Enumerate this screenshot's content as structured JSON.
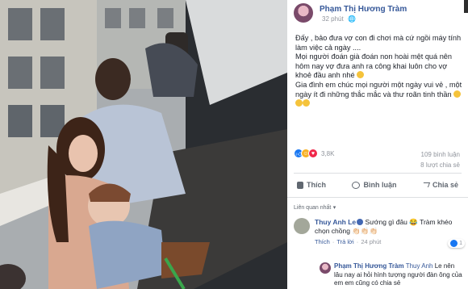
{
  "post": {
    "author": "Phạm Thị Hương Tràm",
    "time": "32 phút",
    "paragraphs": [
      "Đấy , bảo đưa vợ con đi chơi mà cứ ngồi máy tính làm việc cả ngày ....",
      "Mọi người đoán già đoán non hoài mệt quá nên hôm nay vợ đưa anh ra công khai luôn cho vợ khoẻ đầu anh nhé",
      "Gia đình em chúc mọi người một ngày vui vẻ , một ngày ít đi những thắc mắc và thư roãn tinh thần"
    ]
  },
  "reactions": {
    "count": "3,8K",
    "comments": "109 bình luận",
    "shares": "8 lượt chia sẻ"
  },
  "actions": {
    "like": "Thích",
    "comment": "Bình luận",
    "share": "Chia sẻ"
  },
  "sort_label": "Liên quan nhất",
  "comments": [
    {
      "author": "Thuy Anh Le",
      "text": "Sướng gì đâu 😂 Tràm khéo chọn chồng 👏🏻👏🏻👏🏻",
      "like": "Thích",
      "reply": "Trả lời",
      "time": "24 phút",
      "like_count": "1"
    }
  ],
  "reply": {
    "author": "Phạm Thị Hương Tràm",
    "mention": "Thuy Anh",
    "text": "Le nên lâu nay ai hỏi hình tượng người đàn ông của em em cũng có chia sẻ"
  },
  "icons": [
    "globe-icon",
    "like-icon",
    "haha-icon",
    "love-icon",
    "comment-icon",
    "share-icon",
    "verified-icon"
  ]
}
